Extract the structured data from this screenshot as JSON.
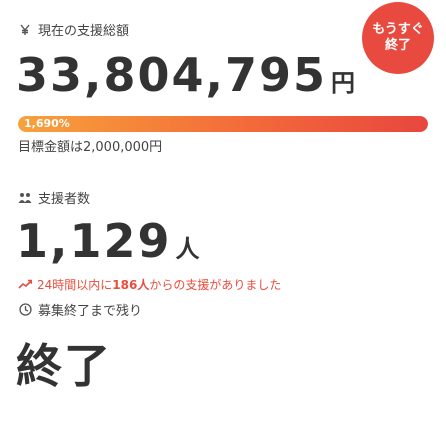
{
  "funding": {
    "icon": "yen-icon",
    "label": "現在の支援総額",
    "amount": "33,804,795",
    "unit": "円",
    "progress_percent_label": "1,690%",
    "progress_fraction": 1.0,
    "goal_text": "目標金額は2,000,000円"
  },
  "badge": {
    "line1": "もうすぐ",
    "line2": "終了",
    "color": "#e94a3f"
  },
  "supporters": {
    "icon": "people-icon",
    "label": "支援者数",
    "count": "1,129",
    "unit": "人",
    "recent_prefix": "24時間以内に",
    "recent_count": "186人",
    "recent_suffix": "からの支援がありました",
    "trend_icon": "trend-up-icon",
    "accent": "#e84d3d"
  },
  "remaining": {
    "icon": "clock-icon",
    "label": "募集終了まで残り",
    "value": "終了"
  }
}
